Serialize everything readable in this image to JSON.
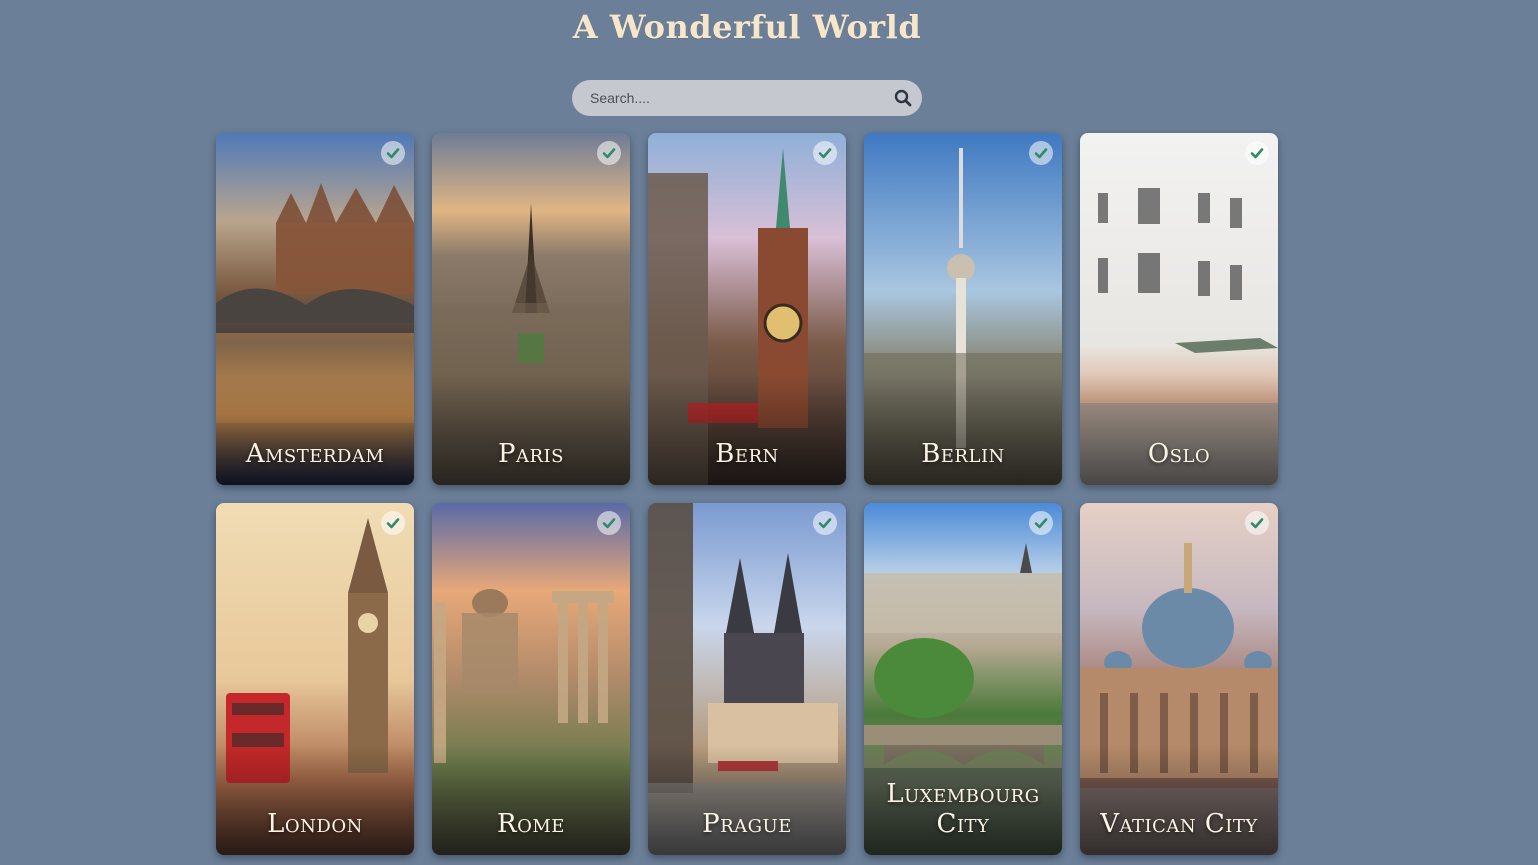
{
  "header": {
    "title": "A Wonderful World"
  },
  "search": {
    "placeholder": "Search....",
    "value": "",
    "icon": "search-icon"
  },
  "colors": {
    "background": "#6b7f99",
    "title": "#f7e6c9",
    "search_bg": "#c5c9cf",
    "check": "#2e8a69"
  },
  "cities": [
    {
      "name": "Amsterdam",
      "selected": true,
      "theme": "canal-houses-at-dusk"
    },
    {
      "name": "Paris",
      "selected": true,
      "theme": "eiffel-tower-skyline"
    },
    {
      "name": "Bern",
      "selected": true,
      "theme": "clock-tower-street"
    },
    {
      "name": "Berlin",
      "selected": true,
      "theme": "tv-tower-skyline"
    },
    {
      "name": "Oslo",
      "selected": true,
      "theme": "white-corner-building"
    },
    {
      "name": "London",
      "selected": true,
      "theme": "big-ben-red-bus"
    },
    {
      "name": "Rome",
      "selected": true,
      "theme": "roman-forum-ruins"
    },
    {
      "name": "Prague",
      "selected": true,
      "theme": "tyn-church-square"
    },
    {
      "name": "Luxembourg City",
      "selected": true,
      "theme": "old-town-bridge"
    },
    {
      "name": "Vatican City",
      "selected": true,
      "theme": "st-peters-basilica"
    }
  ]
}
